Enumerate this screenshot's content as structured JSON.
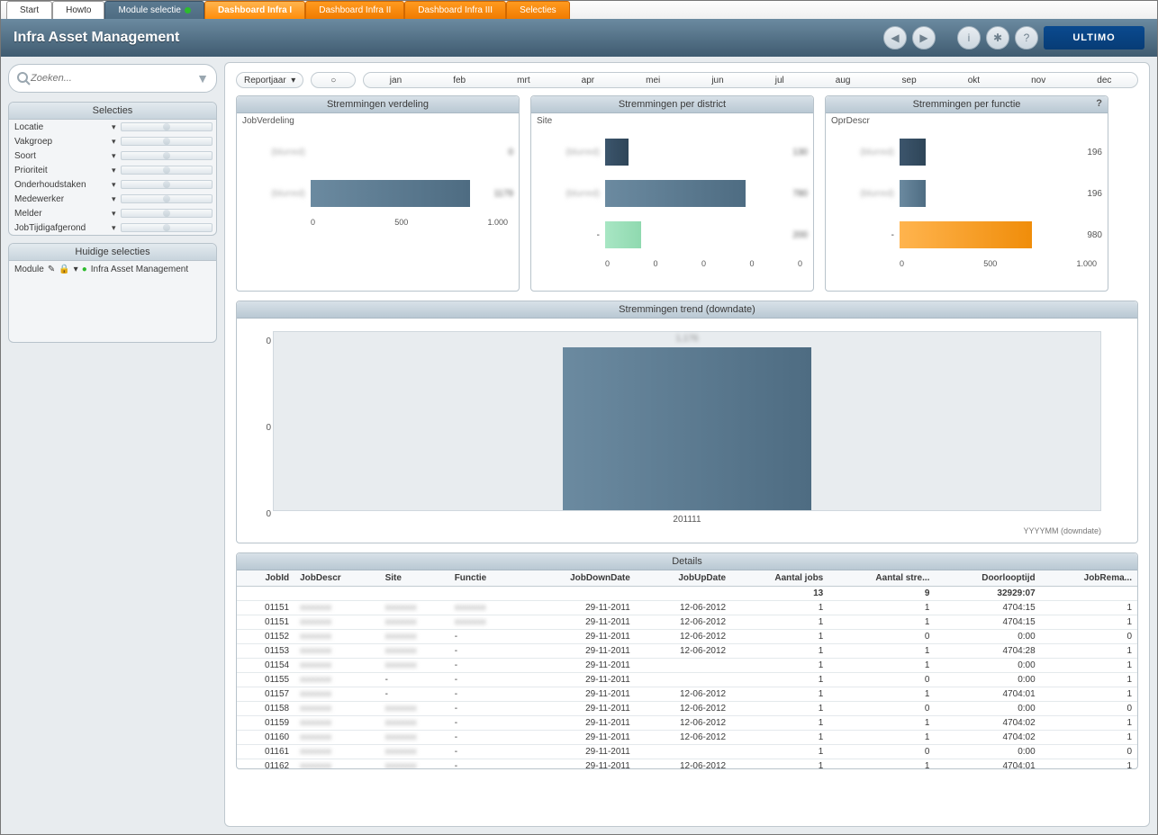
{
  "tabs": [
    "Start",
    "Howto",
    "Module selectie",
    "Dashboard Infra I",
    "Dashboard Infra II",
    "Dashboard Infra III",
    "Selecties"
  ],
  "active_tab_index": 3,
  "header": {
    "title": "Infra Asset Management",
    "logo": "ULTIMO"
  },
  "search": {
    "placeholder": "Zoeken..."
  },
  "selecties": {
    "title": "Selecties",
    "rows": [
      "Locatie",
      "Vakgroep",
      "Soort",
      "Prioriteit",
      "Onderhoudstaken",
      "Medewerker",
      "Melder",
      "JobTijdigafgerond"
    ]
  },
  "huidige": {
    "title": "Huidige selecties",
    "module_label": "Module",
    "value": "Infra Asset Management"
  },
  "filters": {
    "reportjaar_label": "Reportjaar",
    "months": [
      "jan",
      "feb",
      "mrt",
      "apr",
      "mei",
      "jun",
      "jul",
      "aug",
      "sep",
      "okt",
      "nov",
      "dec"
    ]
  },
  "cards": {
    "verdeling": {
      "title": "Stremmingen verdeling",
      "dim": "JobVerdeling"
    },
    "district": {
      "title": "Stremmingen per district",
      "dim": "Site"
    },
    "functie": {
      "title": "Stremmingen per functie",
      "dim": "OprDescr"
    },
    "trend": {
      "title": "Stremmingen trend (downdate)",
      "xlabel": "201111",
      "sublabel": "YYYYMM (downdate)"
    }
  },
  "chart_data": [
    {
      "id": "verdeling",
      "type": "bar",
      "orientation": "horizontal",
      "categories": [
        "(blurred)",
        "(blurred)"
      ],
      "values": [
        0,
        1179
      ],
      "xlim": [
        0,
        1200
      ],
      "xticks": [
        "0",
        "500",
        "1.000"
      ]
    },
    {
      "id": "district",
      "type": "bar",
      "orientation": "horizontal",
      "categories": [
        "(blurred)",
        "(blurred)",
        "-"
      ],
      "values": [
        130,
        780,
        200
      ],
      "series_colors": [
        "darkblue",
        "bluebar",
        "mint"
      ],
      "xlim": [
        0,
        900
      ],
      "xticks": [
        "0",
        "0",
        "0",
        "0",
        "0"
      ]
    },
    {
      "id": "functie",
      "type": "bar",
      "orientation": "horizontal",
      "categories": [
        "(blurred)",
        "(blurred)",
        "-"
      ],
      "values": [
        196,
        196,
        980
      ],
      "series_colors": [
        "darkblue",
        "bluebar",
        "orange"
      ],
      "xlim": [
        0,
        1200
      ],
      "xticks": [
        "0",
        "500",
        "1.000"
      ]
    },
    {
      "id": "trend",
      "type": "bar",
      "categories": [
        "201111"
      ],
      "values": [
        1176
      ],
      "ylim": [
        0,
        1300
      ],
      "yticks": [
        "0",
        "0",
        "0"
      ],
      "xlabel": "YYYYMM (downdate)"
    }
  ],
  "details": {
    "title": "Details",
    "columns": [
      "JobId",
      "JobDescr",
      "Site",
      "Functie",
      "JobDownDate",
      "JobUpDate",
      "Aantal jobs",
      "Aantal stre...",
      "Doorlooptijd",
      "JobRema..."
    ],
    "totals": {
      "aantal_jobs": 13,
      "aantal_stre": 9,
      "doorloop": "32929:07"
    },
    "rows": [
      {
        "id": "01151",
        "descr": "(blurred)",
        "site": "(blurred)",
        "functie": "(blurred)",
        "down": "29-11-2011",
        "up": "12-06-2012",
        "jobs": 1,
        "stre": 1,
        "door": "4704:15",
        "rema": 1
      },
      {
        "id": "01151",
        "descr": "(blurred)",
        "site": "(blurred)",
        "functie": "(blurred)",
        "down": "29-11-2011",
        "up": "12-06-2012",
        "jobs": 1,
        "stre": 1,
        "door": "4704:15",
        "rema": 1
      },
      {
        "id": "01152",
        "descr": "(blurred)",
        "site": "(blurred)",
        "functie": "-",
        "down": "29-11-2011",
        "up": "12-06-2012",
        "jobs": 1,
        "stre": 0,
        "door": "0:00",
        "rema": 0
      },
      {
        "id": "01153",
        "descr": "(blurred)",
        "site": "(blurred)",
        "functie": "-",
        "down": "29-11-2011",
        "up": "12-06-2012",
        "jobs": 1,
        "stre": 1,
        "door": "4704:28",
        "rema": 1
      },
      {
        "id": "01154",
        "descr": "(blurred)",
        "site": "(blurred)",
        "functie": "-",
        "down": "29-11-2011",
        "up": "",
        "jobs": 1,
        "stre": 1,
        "door": "0:00",
        "rema": 1
      },
      {
        "id": "01155",
        "descr": "(blurred)",
        "site": "-",
        "functie": "-",
        "down": "29-11-2011",
        "up": "",
        "jobs": 1,
        "stre": 0,
        "door": "0:00",
        "rema": 1
      },
      {
        "id": "01157",
        "descr": "(blurred)",
        "site": "-",
        "functie": "-",
        "down": "29-11-2011",
        "up": "12-06-2012",
        "jobs": 1,
        "stre": 1,
        "door": "4704:01",
        "rema": 1
      },
      {
        "id": "01158",
        "descr": "(blurred)",
        "site": "(blurred)",
        "functie": "-",
        "down": "29-11-2011",
        "up": "12-06-2012",
        "jobs": 1,
        "stre": 0,
        "door": "0:00",
        "rema": 0
      },
      {
        "id": "01159",
        "descr": "(blurred)",
        "site": "(blurred)",
        "functie": "-",
        "down": "29-11-2011",
        "up": "12-06-2012",
        "jobs": 1,
        "stre": 1,
        "door": "4704:02",
        "rema": 1
      },
      {
        "id": "01160",
        "descr": "(blurred)",
        "site": "(blurred)",
        "functie": "-",
        "down": "29-11-2011",
        "up": "12-06-2012",
        "jobs": 1,
        "stre": 1,
        "door": "4704:02",
        "rema": 1
      },
      {
        "id": "01161",
        "descr": "(blurred)",
        "site": "(blurred)",
        "functie": "-",
        "down": "29-11-2011",
        "up": "",
        "jobs": 1,
        "stre": 0,
        "door": "0:00",
        "rema": 0
      },
      {
        "id": "01162",
        "descr": "(blurred)",
        "site": "(blurred)",
        "functie": "-",
        "down": "29-11-2011",
        "up": "12-06-2012",
        "jobs": 1,
        "stre": 1,
        "door": "4704:01",
        "rema": 1
      }
    ]
  }
}
